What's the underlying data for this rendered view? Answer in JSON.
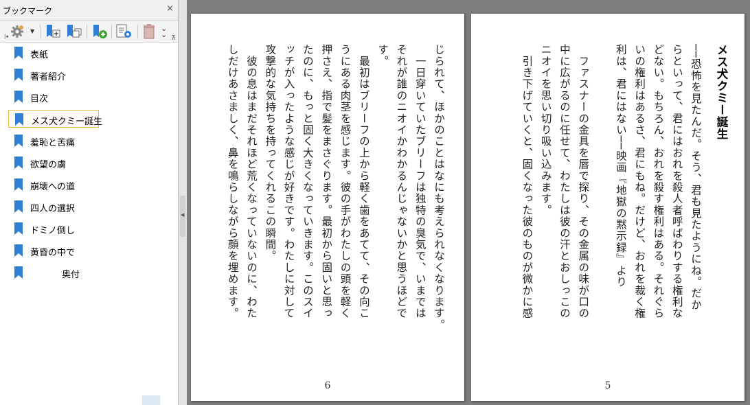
{
  "panel": {
    "title": "ブックマーク",
    "close": "×"
  },
  "icons": {
    "options": "gear-icon",
    "expand": "bookmark-expand-icon",
    "collapse": "bookmark-collapse-icon",
    "new_bookmark": "new-bookmark-icon",
    "properties": "bookmark-properties-icon",
    "delete": "trash-icon",
    "more": "double-chevron-down-icon",
    "bookmark": "bookmark-ribbon-icon"
  },
  "colors": {
    "bookmark_blue": "#2f7fd6",
    "selected_border": "#e8b84a",
    "viewport_bg": "#7d7d7d"
  },
  "bookmarks": [
    {
      "label": "表紙"
    },
    {
      "label": "著者紹介"
    },
    {
      "label": "目次"
    },
    {
      "label": "メス犬クミー誕生",
      "selected": true
    },
    {
      "label": "羞恥と苦痛"
    },
    {
      "label": "欲望の虜"
    },
    {
      "label": "崩壊への道"
    },
    {
      "label": "四人の選択"
    },
    {
      "label": "ドミノ倒し"
    },
    {
      "label": "黄昏の中で"
    },
    {
      "label": "奥付"
    }
  ],
  "pages": {
    "right": {
      "title": "メス犬クミー誕生",
      "text": "──恐怖を見たんだ。そう、君も見たようにね。だか\nらといって、君にはおれを殺人者呼ばわりする権利な\nどない。もちろん、おれを殺す権利はある。それぐら\nいの権利はあるさ、君にもね。だけど、おれを裁く権\n利は、君にはない──映画『地獄の黙示録』より\n\n　ファスナーの金具を唇で探り、その金属の味が口の\n中に広がるのに任せて、わたしは彼の汗とおしっこの\nニオイを思い切り吸い込みます。\n　引き下げていくと、固くなった彼のものが微かに感",
      "number": "5"
    },
    "left": {
      "text": "じられて、ほかのことはなにも考えられなくなります。\n　一日穿いていたブリーフは独特の臭気で、いまでは\nそれが誰のニオイかわかるんじゃないかと思うほどで\nす。\n　最初はブリーフの上から軽く歯をあてて、その向こ\nうにある肉茎を感じます。彼の手がわたしの頭を軽く\n押さえ、指で髪をまさぐります。最初から固いと思っ\nたのに、もっと固く大きくなっていきます。このスイ\nッチが入ったような感じが好きです。わたしに対して\n攻撃的な気持ちを持ってくれるこの瞬間。\n　彼の息はまだそれほど荒くなっていないのに、わた\nしだけあさましく、鼻を鳴らしながら顔を埋めます。",
      "number": "6"
    }
  }
}
